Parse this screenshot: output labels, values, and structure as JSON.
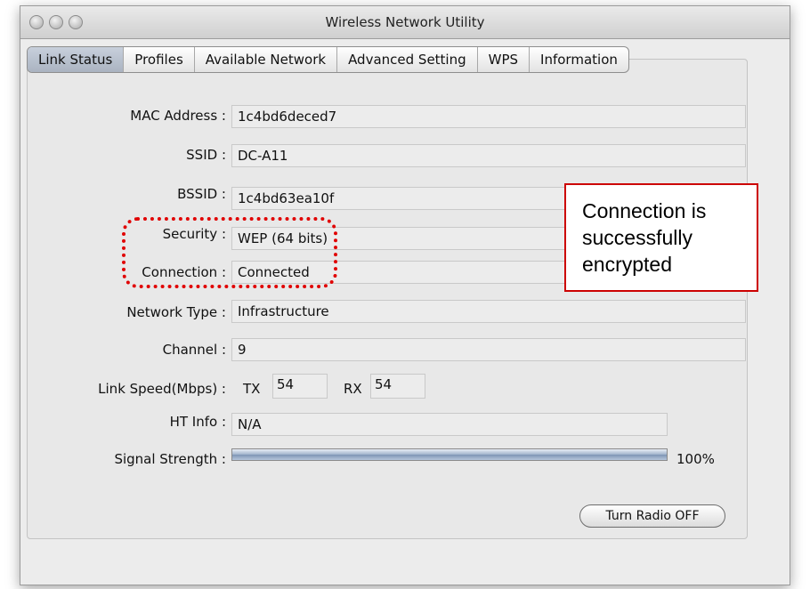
{
  "window": {
    "title": "Wireless Network Utility"
  },
  "tabs": [
    {
      "label": "Link Status",
      "active": true
    },
    {
      "label": "Profiles"
    },
    {
      "label": "Available Network"
    },
    {
      "label": "Advanced Setting"
    },
    {
      "label": "WPS"
    },
    {
      "label": "Information"
    }
  ],
  "fields": {
    "mac": {
      "label": "MAC Address :",
      "value": "1c4bd6deced7"
    },
    "ssid": {
      "label": "SSID :",
      "value": "DC-A11"
    },
    "bssid": {
      "label": "BSSID :",
      "value": "1c4bd63ea10f"
    },
    "security": {
      "label": "Security :",
      "value": "WEP (64 bits)"
    },
    "connection": {
      "label": "Connection :",
      "value": "Connected"
    },
    "network_type": {
      "label": "Network Type :",
      "value": "Infrastructure"
    },
    "channel": {
      "label": "Channel :",
      "value": "9"
    },
    "link_speed": {
      "label": "Link Speed(Mbps) :",
      "tx_label": "TX",
      "tx": "54",
      "rx_label": "RX",
      "rx": "54"
    },
    "ht_info": {
      "label": "HT Info :",
      "value": "N/A"
    },
    "signal": {
      "label": "Signal Strength :",
      "percent_text": "100%",
      "level": 1.0
    }
  },
  "button": {
    "label": "Turn Radio OFF"
  },
  "callout": {
    "lines": [
      "Connection is",
      "successfully",
      "encrypted"
    ]
  },
  "colors": {
    "annotation_red": "#cc0000"
  }
}
